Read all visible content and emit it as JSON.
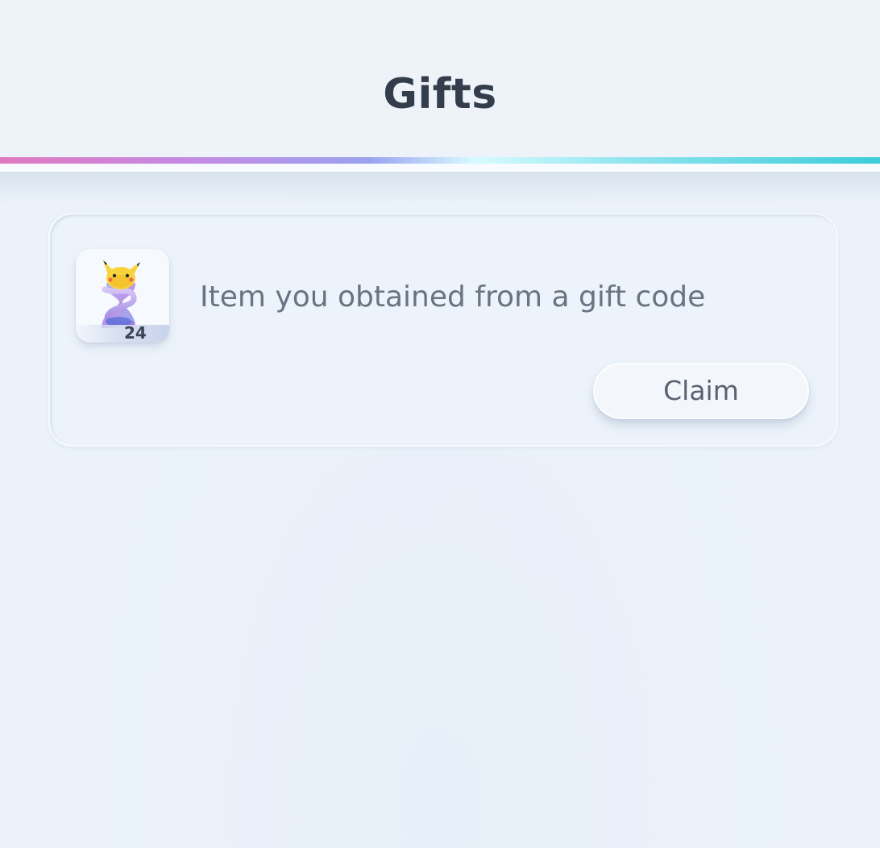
{
  "header": {
    "title": "Gifts"
  },
  "gift": {
    "description": "Item you obtained from a gift code",
    "item_icon": "pikachu-hourglass-icon",
    "quantity": "24",
    "claim_label": "Claim"
  },
  "colors": {
    "title_text": "#333d4b",
    "body_text": "#6b7281",
    "button_text": "#5a6272",
    "background": "#edf3f9",
    "accent_gradient": [
      "#e07ac0",
      "#c48ae4",
      "#9aa2ee",
      "#d7fbff",
      "#8ee4ee",
      "#3bcdd8"
    ]
  }
}
